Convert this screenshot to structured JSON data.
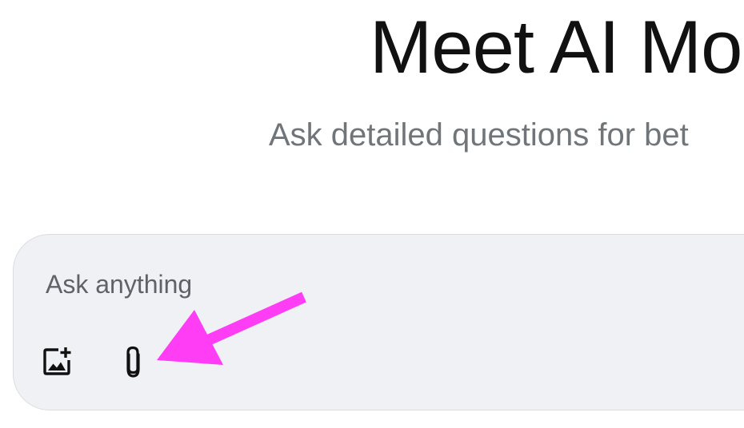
{
  "header": {
    "title": "Meet AI Mo",
    "subtitle": "Ask detailed questions for bet"
  },
  "prompt": {
    "placeholder": "Ask anything",
    "value": ""
  },
  "toolbar": {
    "buttons": [
      {
        "icon": "add-image-icon"
      },
      {
        "icon": "paperclip-icon"
      }
    ]
  },
  "annotation": {
    "arrow_color": "#ff3df5",
    "target": "paperclip-icon"
  },
  "colors": {
    "title": "#111111",
    "subtitle": "#70757a",
    "input_background": "#f0f1f5",
    "input_border": "#dadce0",
    "icon": "#111111"
  }
}
